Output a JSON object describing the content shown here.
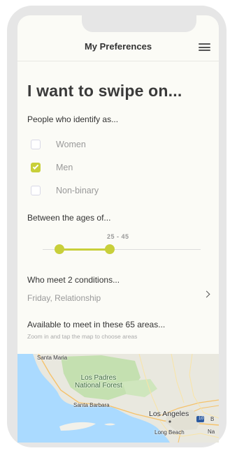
{
  "header": {
    "title": "My Preferences"
  },
  "headline": "I want to swipe on...",
  "identity": {
    "label": "People who identify as...",
    "options": [
      {
        "label": "Women",
        "checked": false
      },
      {
        "label": "Men",
        "checked": true
      },
      {
        "label": "Non-binary",
        "checked": false
      }
    ]
  },
  "age": {
    "label": "Between the ages of...",
    "range_text": "25 - 45",
    "min": 25,
    "max": 45
  },
  "conditions": {
    "label": "Who meet 2 conditions...",
    "value": "Friday, Relationship"
  },
  "areas": {
    "label": "Available to meet in these 65 areas...",
    "hint": "Zoom in and tap the map to choose areas"
  },
  "map": {
    "labels": {
      "santa_maria": "Santa Maria",
      "los_padres": "Los Padres\nNational Forest",
      "santa_barbara": "Santa Barbara",
      "los_angeles": "Los Angeles",
      "long_beach": "Long Beach",
      "edge_b": "B",
      "edge_na": "Na"
    },
    "highway_shield": "10"
  },
  "colors": {
    "accent": "#c8cf3a",
    "background": "#fbfbf6",
    "frame": "#e6e6e6",
    "muted_text": "#999999",
    "water": "#aadaff",
    "park": "#c4e0b0"
  },
  "icons": {
    "menu": "hamburger-icon",
    "chevron": "chevron-right-icon",
    "check": "check-icon"
  }
}
